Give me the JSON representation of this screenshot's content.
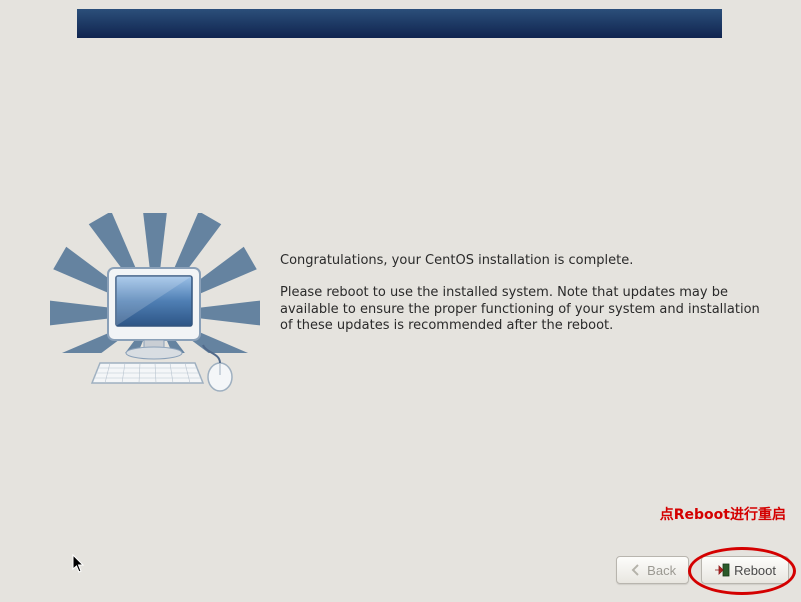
{
  "text": {
    "congrats": "Congratulations, your CentOS installation is complete.",
    "reboot_msg": "Please reboot to use the installed system.  Note that updates may be available to ensure the proper functioning of your system and installation of these updates is recommended after the reboot."
  },
  "buttons": {
    "back": "Back",
    "reboot": "Reboot"
  },
  "annotation": "点Reboot进行重启"
}
